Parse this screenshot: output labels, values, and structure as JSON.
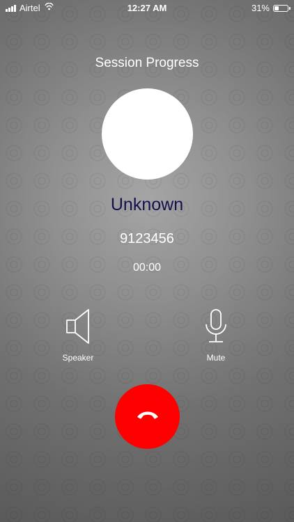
{
  "status_bar": {
    "carrier": "Airtel",
    "time": "12:27 AM",
    "battery_percent": "31%",
    "battery_level": 0.31,
    "signal_bars": 4,
    "icons": [
      "signal-icon",
      "wifi-calling-icon",
      "battery-icon"
    ]
  },
  "call": {
    "title": "Session Progress",
    "caller_name": "Unknown",
    "caller_number": "9123456",
    "duration": "00:00"
  },
  "controls": {
    "speaker": {
      "label": "Speaker",
      "icon": "speaker-icon"
    },
    "mute": {
      "label": "Mute",
      "icon": "microphone-icon"
    },
    "end_call": {
      "icon": "hang-up-icon",
      "color": "#ff0000"
    }
  },
  "colors": {
    "caller_name": "#12114d",
    "end_call": "#ff0000",
    "text": "#ffffff"
  }
}
